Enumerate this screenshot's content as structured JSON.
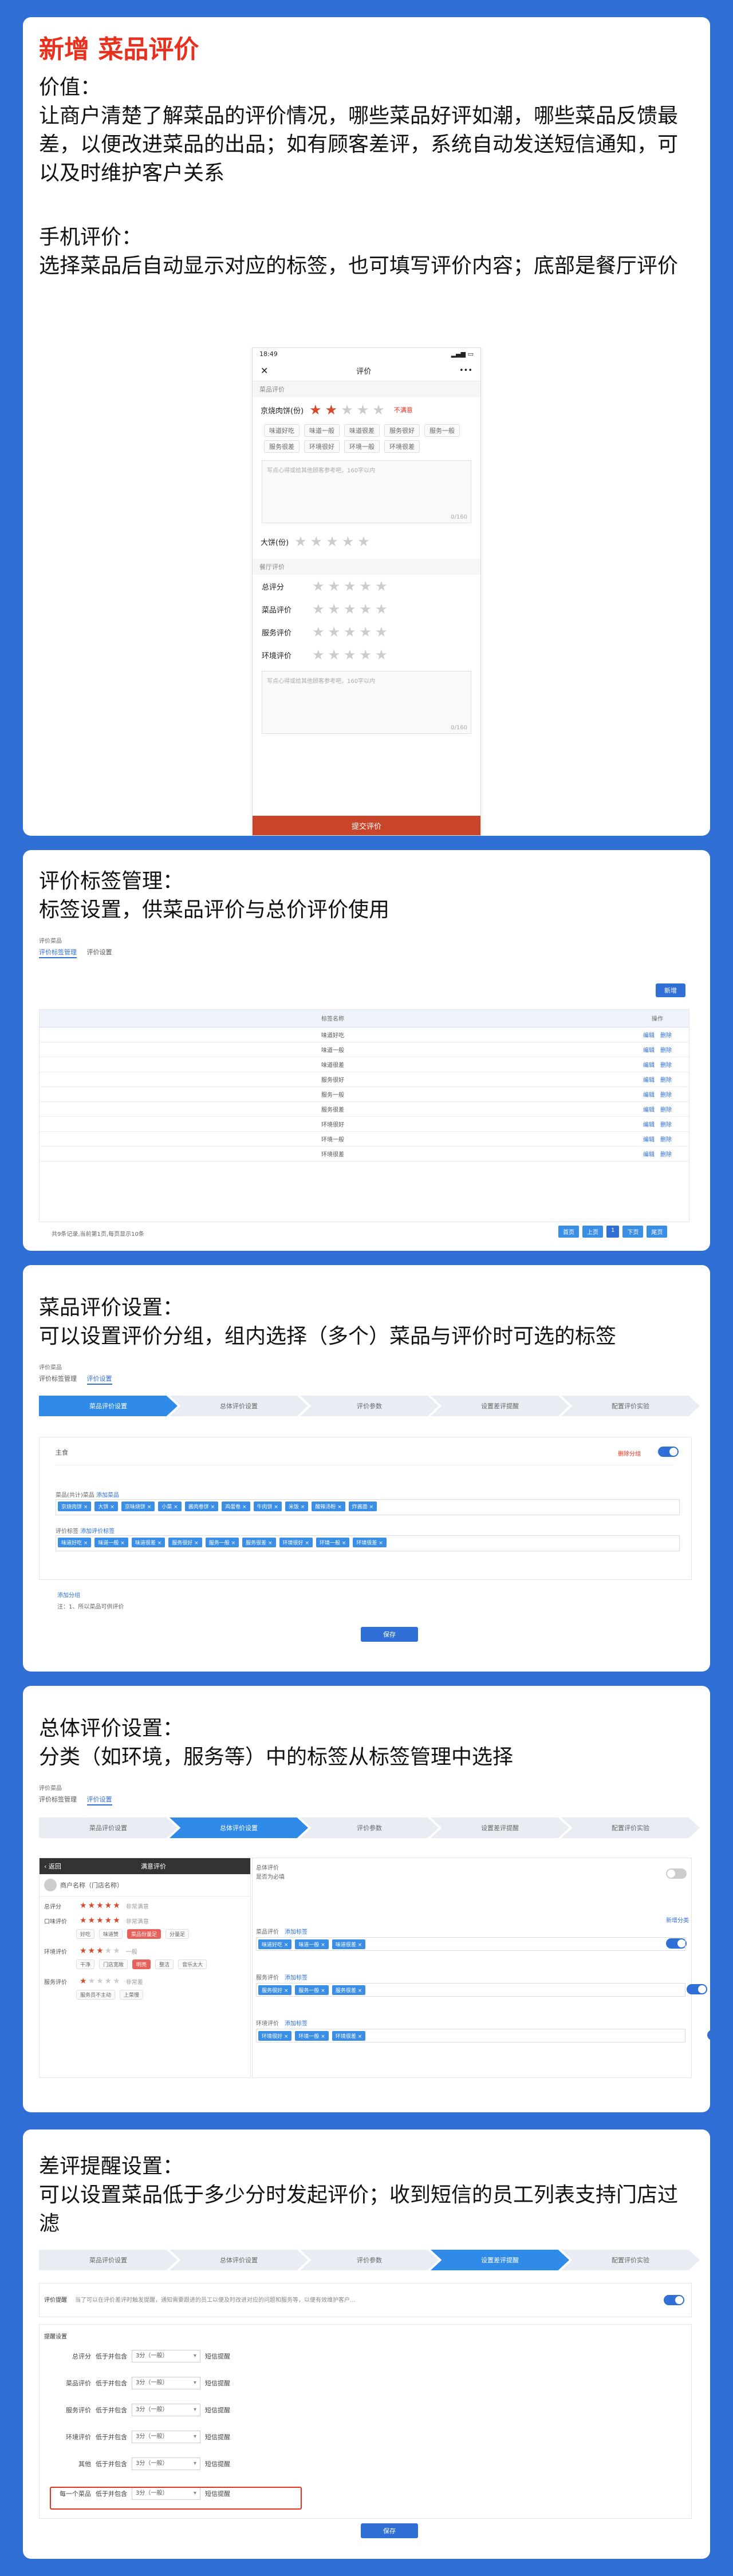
{
  "card1": {
    "title": "新增  菜品评价",
    "value_label": "价值：",
    "value_text": "让商户清楚了解菜品的评价情况，哪些菜品好评如潮，哪些菜品反馈最差，以便改进菜品的出品；如有顾客差评，系统自动发送短信通知，可以及时维护客户关系",
    "mobile_label": "手机评价：",
    "mobile_text": "选择菜品后自动显示对应的标签，也可填写评价内容；底部是餐厅评价",
    "phone": {
      "time": "18:49",
      "title": "评价",
      "dish_section": "菜品评价",
      "dish1_name": "京烧肉饼(份)",
      "dish1_rating": 2,
      "dish1_status": "不满意",
      "dish1_tags": [
        "味道好吃",
        "味道一般",
        "味道很差",
        "服务很好",
        "服务一般",
        "服务很差",
        "环境很好",
        "环境一般",
        "环境很差"
      ],
      "comment_placeholder": "写点心得或给其他顾客参考吧，160字以内",
      "comment_count": "0/160",
      "dish2_name": "大饼(份)",
      "dish2_rating": 0,
      "rest_section": "餐厅评价",
      "rest_items": [
        "总评分",
        "菜品评价",
        "服务评价",
        "环境评价"
      ],
      "rest_comment_placeholder": "写点心得或给其他顾客参考吧，160字以内",
      "rest_comment_count": "0/160",
      "submit": "提交评价"
    }
  },
  "card2": {
    "heading": "评价标签管理：",
    "subheading": "标签设置，供菜品评价与总价评价使用",
    "breadcrumb": "评价菜品",
    "tabs": [
      "评价标签管理",
      "评价设置"
    ],
    "add_button": "新增",
    "columns": [
      "标签名称",
      "操作"
    ],
    "rows": [
      "味道好吃",
      "味道一般",
      "味道很差",
      "服务很好",
      "服务一般",
      "服务很差",
      "环境很好",
      "环境一般",
      "环境很差"
    ],
    "op_edit": "编辑",
    "op_delete": "删除",
    "footer": "共9条记录,当前第1页,每页显示10条",
    "pager": [
      "首页",
      "上页",
      "1",
      "下页",
      "尾页"
    ]
  },
  "card3": {
    "heading": "菜品评价设置：",
    "subheading": "可以设置评价分组，组内选择（多个）菜品与评价时可选的标签",
    "breadcrumb": "评价菜品",
    "tabs": [
      "评价标签管理",
      "评价设置"
    ],
    "steps": [
      "菜品评价设置",
      "总体评价设置",
      "评价参数",
      "设置差评提醒",
      "配置评价实验"
    ],
    "group_name": "主食",
    "group_toggle_label": "删除分组",
    "dish_field_label": "菜品(共计)菜品",
    "dish_link": "添加菜品",
    "dish_tags": [
      "京烧肉饼",
      "大饼",
      "京味烧饼",
      "小菜",
      "酱肉卷饼",
      "鸡蛋卷",
      "牛肉饼",
      "米饭",
      "酸辣汤粉",
      "炸酱面"
    ],
    "tag_field_label": "评价标签",
    "tag_link": "添加评价标签",
    "tag_tags": [
      "味道好吃",
      "味道一般",
      "味道很差",
      "服务很好",
      "服务一般",
      "服务很差",
      "环境很好",
      "环境一般",
      "环境很差"
    ],
    "add_group_link": "添加分组",
    "note": "注：1、所以菜品可供评价",
    "save": "保存"
  },
  "card4": {
    "heading": "总体评价设置：",
    "subheading": "分类（如环境，服务等）中的标签从标签管理中选择",
    "breadcrumb": "评价菜品",
    "tabs": [
      "评价标签管理",
      "评价设置"
    ],
    "steps": [
      "菜品评价设置",
      "总体评价设置",
      "评价参数",
      "设置差评提醒",
      "配置评价实验"
    ],
    "phone_back": "返回",
    "phone_title": "满意评价",
    "phone_shop": "商户名称（门店名称）",
    "phone_rows": [
      {
        "label": "总评分",
        "rating": 5,
        "note": "非常满意"
      },
      {
        "label": "口味评价",
        "rating": 5,
        "note": "非常满意"
      },
      {
        "label": "环境评价",
        "rating": 3,
        "note": "一般"
      },
      {
        "label": "服务评价",
        "rating": 1,
        "note": "非常差"
      }
    ],
    "phone_tags1": [
      "好吃",
      "味道赞",
      "菜品份量足",
      "分量足"
    ],
    "phone_tags2": [
      "干净",
      "门店宽敞",
      "明亮",
      "整洁",
      "音乐太大"
    ],
    "phone_tags3": [
      "服务员不主动",
      "上菜慢"
    ],
    "overall_label": "总体评价",
    "overall_sub": "是否为必填",
    "cat_link": "新增分类",
    "cats": [
      {
        "name": "菜品评价",
        "link": "添加标签",
        "tags": [
          "味道好吃",
          "味道一般",
          "味道很差"
        ]
      },
      {
        "name": "服务评价",
        "link": "添加标签",
        "tags": [
          "服务很好",
          "服务一般",
          "服务很差"
        ]
      },
      {
        "name": "环境评价",
        "link": "添加标签",
        "tags": [
          "环境很好",
          "环境一般",
          "环境很差"
        ]
      }
    ]
  },
  "card5": {
    "heading": "差评提醒设置：",
    "subheading": "可以设置菜品低于多少分时发起评价；收到短信的员工列表支持门店过滤",
    "steps": [
      "菜品评价设置",
      "总体评价设置",
      "评价参数",
      "设置差评提醒",
      "配置评价实验"
    ],
    "remind_label": "评价提醒",
    "remind_desc": "当了可以在评价差评时触发提醒，通知需要跟进的员工以便及时改进对应的问题和服务等，以便有效维护客户...",
    "settings_label": "提醒设置",
    "rows": [
      {
        "label": "总评分",
        "cond": "低于并包含",
        "value": "3分（一般）",
        "action": "短信提醒"
      },
      {
        "label": "菜品评价",
        "cond": "低于并包含",
        "value": "3分（一般）",
        "action": "短信提醒"
      },
      {
        "label": "服务评价",
        "cond": "低于并包含",
        "value": "3分（一般）",
        "action": "短信提醒"
      },
      {
        "label": "环境评价",
        "cond": "低于并包含",
        "value": "3分（一般）",
        "action": "短信提醒"
      },
      {
        "label": "其他",
        "cond": "低于并包含",
        "value": "3分（一般）",
        "action": "短信提醒"
      },
      {
        "label": "每一个菜品",
        "cond": "低于并包含",
        "value": "3分（一般）",
        "action": "短信提醒"
      }
    ],
    "save": "保存"
  },
  "colors": {
    "background": "#2f6fd6",
    "title_red": "#e8301e",
    "accent": "#2f6fd6",
    "star": "#d64a2c"
  }
}
